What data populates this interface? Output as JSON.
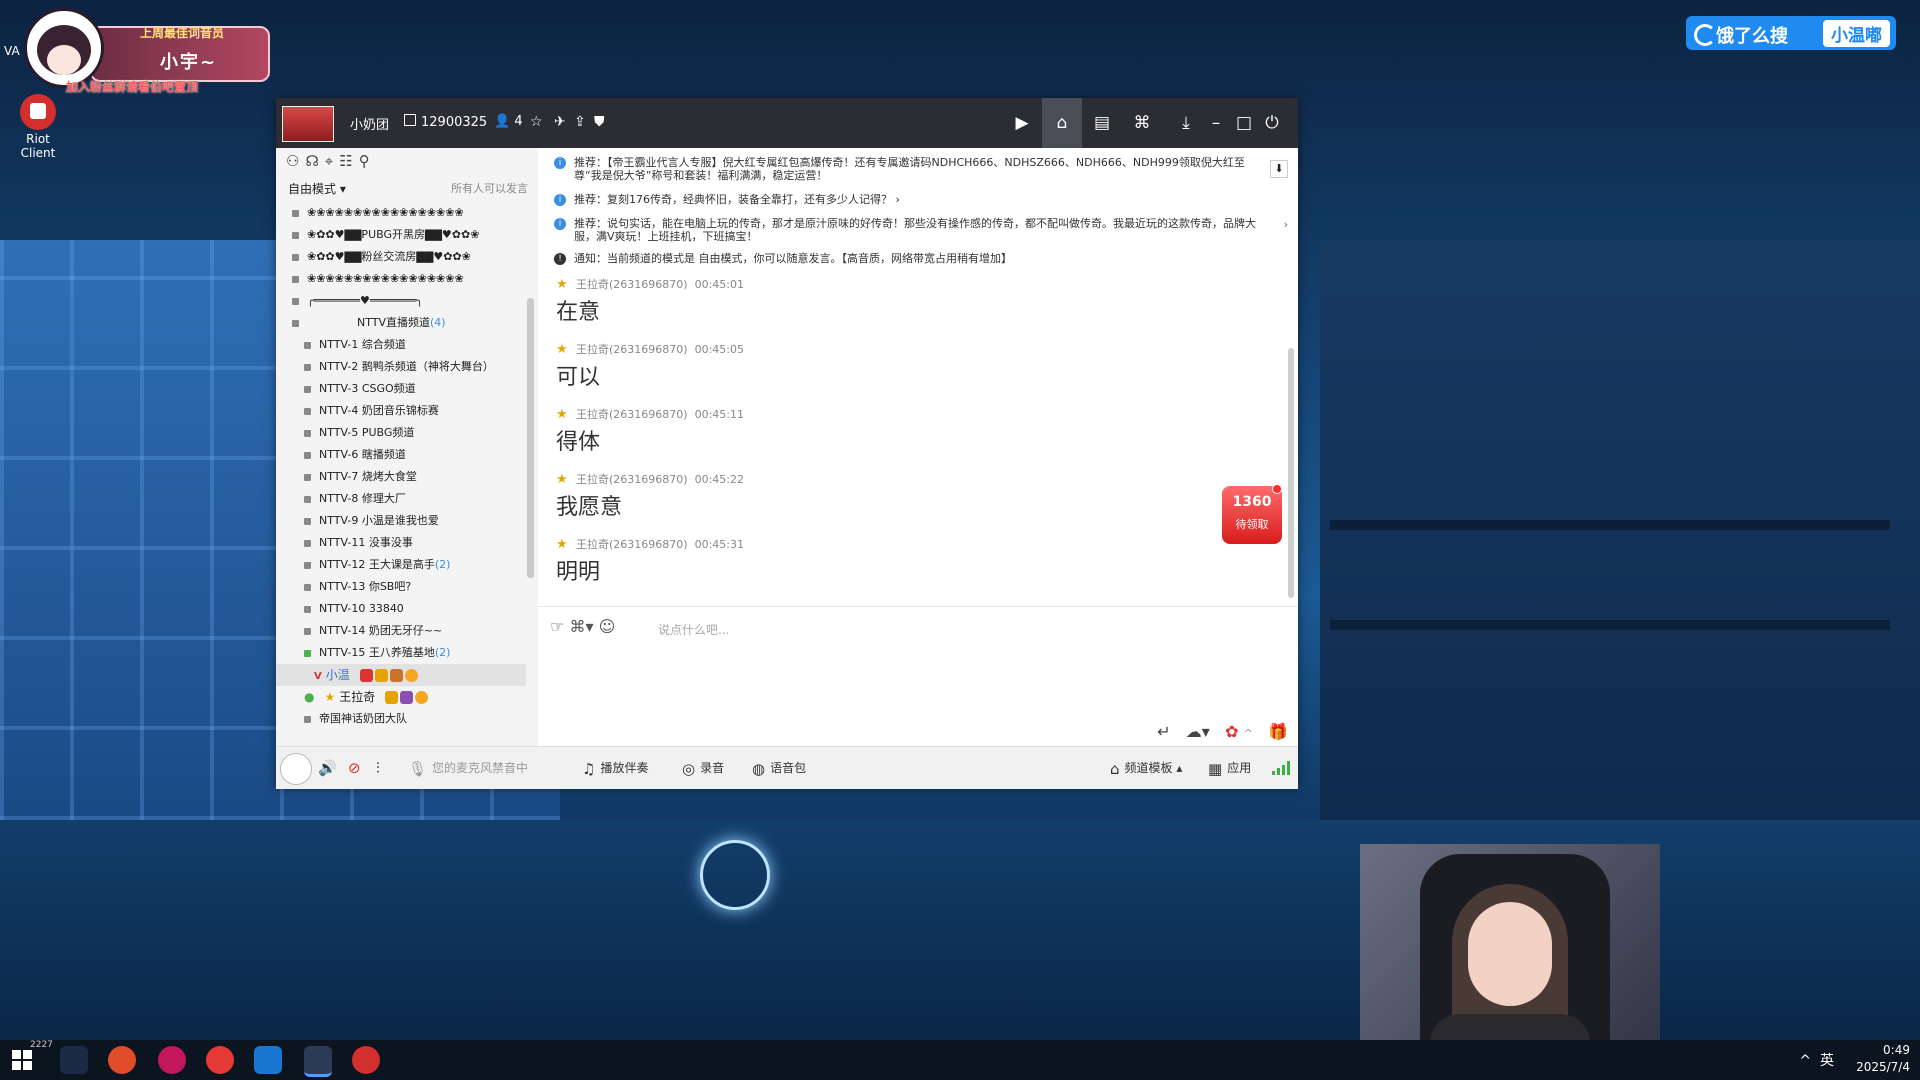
{
  "desktop": {
    "streamer_overlay": {
      "title": "上周最佳词音员",
      "name": "小宇~",
      "subtitle": "加入粉丝群请看伯吧置顶",
      "side_text": "VA"
    },
    "riot_label": "Riot Client",
    "search_badge": {
      "label": "饿了么搜",
      "tag": "小温嘟"
    }
  },
  "app": {
    "title": {
      "channel_name": "小奶团",
      "channel_id": "12900325",
      "user_count": "4"
    },
    "left": {
      "mode": "自由模式",
      "mode_right": "所有人可以发言",
      "tree": [
        {
          "label": "❀❀❀❀❀❀❀❀❀❀❀❀❀❀❀❀❀"
        },
        {
          "label": "❀✿✿♥▇▇PUBG开黑房▇▇♥✿✿❀"
        },
        {
          "label": "❀✿✿♥▇▇粉丝交流房▇▇♥✿✿❀"
        },
        {
          "label": "❀❀❀❀❀❀❀❀❀❀❀❀❀❀❀❀❀"
        },
        {
          "label": "╭═══════♥═══════╮"
        },
        {
          "label": "NTTV直播频道",
          "count": "(4)"
        },
        {
          "label": "NTTV-1 综合频道"
        },
        {
          "label": "NTTV-2 鹅鸭杀频道（神将大舞台）"
        },
        {
          "label": "NTTV-3 CSGO频道"
        },
        {
          "label": "NTTV-4 奶团音乐锦标赛"
        },
        {
          "label": "NTTV-5 PUBG频道"
        },
        {
          "label": "NTTV-6 瞎播频道"
        },
        {
          "label": "NTTV-7 烧烤大食堂"
        },
        {
          "label": "NTTV-8 修理大厂"
        },
        {
          "label": "NTTV-9 小温是谁我也爱"
        },
        {
          "label": "NTTV-11 没事没事"
        },
        {
          "label": "NTTV-12 王大课是高手",
          "count": "(2)"
        },
        {
          "label": "NTTV-13 你SB吧?"
        },
        {
          "label": "NTTV-10 33840"
        },
        {
          "label": "NTTV-14 奶团无牙仔~~"
        },
        {
          "label": "NTTV-15 王八养殖基地",
          "count": "(2)"
        }
      ],
      "users": [
        {
          "name": "小温"
        },
        {
          "name": "王拉奇"
        }
      ],
      "last_item": "帝国神话奶团大队"
    },
    "chat": {
      "notices": [
        "推荐：【帝王霸业代言人专服】倪大红专属红包高爆传奇！还有专属邀请码NDHCH666、NDHSZ666、NDH666、NDH999领取倪大红至尊“我是倪大爷”称号和套装！福利满满，稳定运营！",
        "推荐：复刻176传奇，经典怀旧，装备全靠打，还有多少人记得？",
        "推荐：说句实话，能在电脑上玩的传奇，那才是原汁原味的好传奇！那些没有操作感的传奇，都不配叫做传奇。我最近玩的这款传奇，品牌大服，满V爽玩！上班挂机，下班搞宝！",
        "通知：当前频道的模式是 自由模式，你可以随意发言。【高音质，网络带宽占用稍有增加】"
      ],
      "messages": [
        {
          "user": "王拉奇(2631696870)",
          "time": "00:45:01",
          "text": "在意"
        },
        {
          "user": "王拉奇(2631696870)",
          "time": "00:45:05",
          "text": "可以"
        },
        {
          "user": "王拉奇(2631696870)",
          "time": "00:45:11",
          "text": "得体"
        },
        {
          "user": "王拉奇(2631696870)",
          "time": "00:45:22",
          "text": "我愿意"
        },
        {
          "user": "王拉奇(2631696870)",
          "time": "00:45:31",
          "text": "明明"
        }
      ],
      "reward": {
        "number": "1360",
        "label": "待领取"
      }
    },
    "input": {
      "placeholder": "说点什么吧..."
    },
    "bottom": {
      "mic_status": "您的麦克风禁音中",
      "accompany": "播放伴奏",
      "record": "录音",
      "voice_pack": "语音包",
      "template": "频道模板",
      "apps": "应用"
    }
  },
  "taskbar": {
    "badge_number": "2227",
    "lang": "英",
    "time": "0:49",
    "date": "2025/7/4"
  }
}
